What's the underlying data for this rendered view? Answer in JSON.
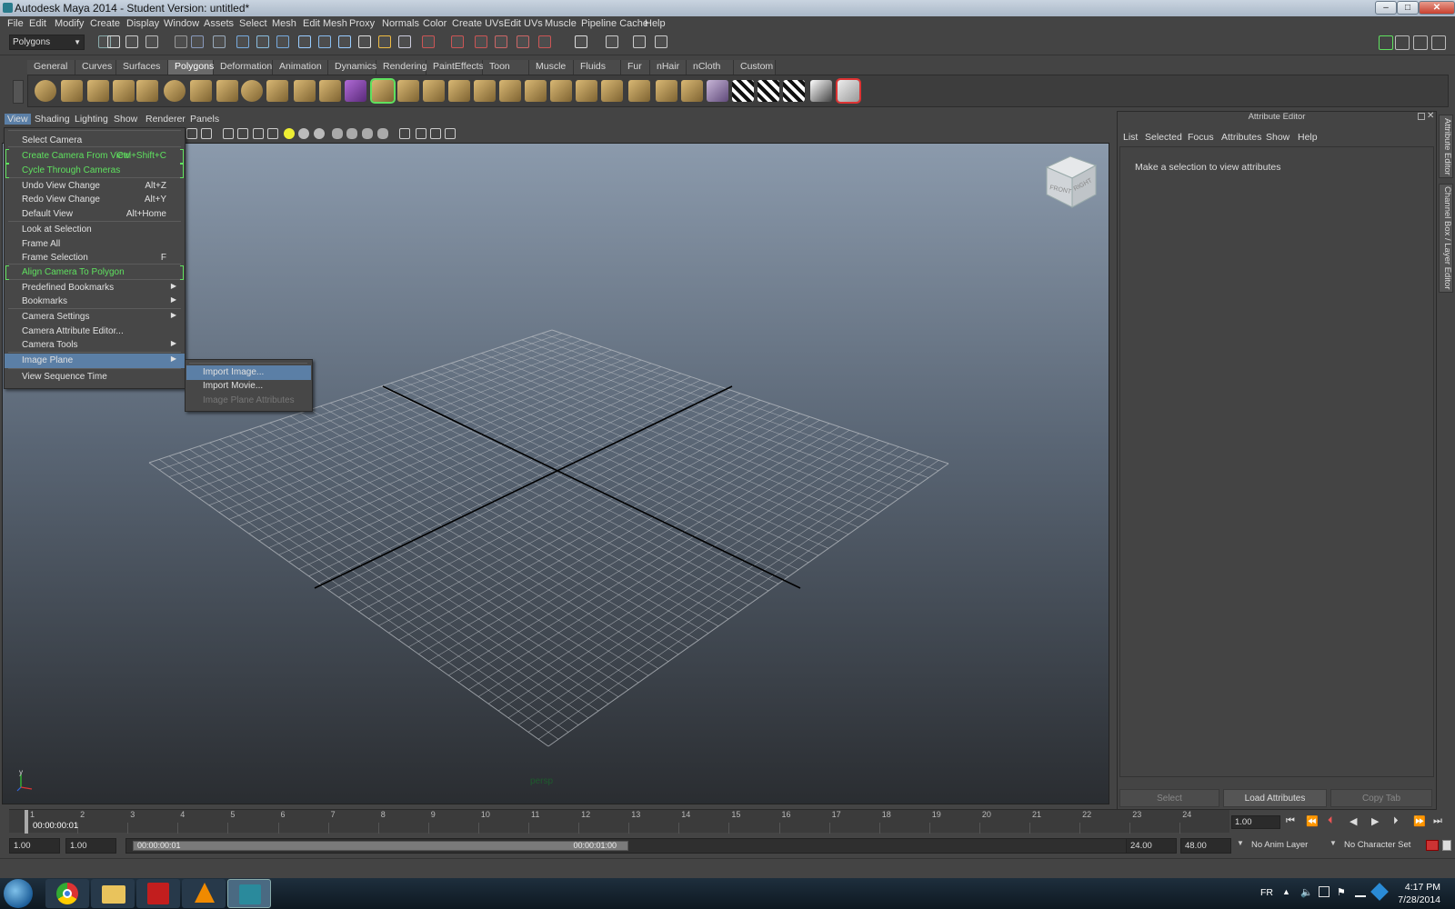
{
  "window": {
    "title": "Autodesk Maya 2014 - Student Version: untitled*",
    "controls": [
      "–",
      "□",
      "✕"
    ]
  },
  "menubar": [
    "File",
    "Edit",
    "Modify",
    "Create",
    "Display",
    "Window",
    "Assets",
    "Select",
    "Mesh",
    "Edit Mesh",
    "Proxy",
    "Normals",
    "Color",
    "Create UVs",
    "Edit UVs",
    "Muscle",
    "Pipeline Cache",
    "Help"
  ],
  "status_line": {
    "mode": "Polygons"
  },
  "shelf": {
    "tabs": [
      "General",
      "Curves",
      "Surfaces",
      "Polygons",
      "Deformation",
      "Animation",
      "Dynamics",
      "Rendering",
      "PaintEffects",
      "Toon",
      "Muscle",
      "Fluids",
      "Fur",
      "nHair",
      "nCloth",
      "Custom"
    ],
    "active_tab": "Polygons"
  },
  "viewport": {
    "menu": [
      "View",
      "Shading",
      "Lighting",
      "Show",
      "Renderer",
      "Panels"
    ],
    "camera_label": "persp",
    "viewcube": {
      "front": "FRONT",
      "right": "RIGHT"
    },
    "axis_label": "y"
  },
  "view_menu": {
    "items": [
      {
        "label": "Select Camera",
        "shortcut": "",
        "green": false,
        "submenu": false
      },
      {
        "label": "Create Camera From View",
        "shortcut": "Ctrl+Shift+C",
        "green": true,
        "submenu": false
      },
      {
        "label": "Cycle Through Cameras",
        "shortcut": "",
        "green": true,
        "submenu": false
      },
      {
        "label": "Undo View Change",
        "shortcut": "Alt+Z",
        "green": false,
        "submenu": false
      },
      {
        "label": "Redo View Change",
        "shortcut": "Alt+Y",
        "green": false,
        "submenu": false
      },
      {
        "label": "Default View",
        "shortcut": "Alt+Home",
        "green": false,
        "submenu": false
      },
      {
        "label": "Look at Selection",
        "shortcut": "",
        "green": false,
        "submenu": false
      },
      {
        "label": "Frame All",
        "shortcut": "",
        "green": false,
        "submenu": false
      },
      {
        "label": "Frame Selection",
        "shortcut": "F",
        "green": false,
        "submenu": false
      },
      {
        "label": "Align Camera To Polygon",
        "shortcut": "",
        "green": true,
        "submenu": false
      },
      {
        "label": "Predefined Bookmarks",
        "shortcut": "",
        "green": false,
        "submenu": true
      },
      {
        "label": "Bookmarks",
        "shortcut": "",
        "green": false,
        "submenu": true
      },
      {
        "label": "Camera Settings",
        "shortcut": "",
        "green": false,
        "submenu": true
      },
      {
        "label": "Camera Attribute Editor...",
        "shortcut": "",
        "green": false,
        "submenu": false
      },
      {
        "label": "Camera Tools",
        "shortcut": "",
        "green": false,
        "submenu": true
      },
      {
        "label": "Image Plane",
        "shortcut": "",
        "green": false,
        "submenu": true,
        "selected": true
      },
      {
        "label": "View Sequence Time",
        "shortcut": "",
        "green": false,
        "submenu": false
      }
    ]
  },
  "image_plane_submenu": {
    "items": [
      {
        "label": "Import Image...",
        "selected": true,
        "disabled": false
      },
      {
        "label": "Import Movie...",
        "selected": false,
        "disabled": false
      },
      {
        "label": "Image Plane Attributes",
        "selected": false,
        "disabled": true
      }
    ]
  },
  "attribute_editor": {
    "title": "Attribute Editor",
    "menu": [
      "List",
      "Selected",
      "Focus",
      "Attributes",
      "Show",
      "Help"
    ],
    "message": "Make a selection to view attributes",
    "buttons": [
      "Select",
      "Load Attributes",
      "Copy Tab"
    ],
    "side_tabs": [
      "Attribute Editor",
      "Channel Box / Layer Editor"
    ]
  },
  "time_slider": {
    "ticks": [
      "1",
      "2",
      "3",
      "4",
      "5",
      "6",
      "7",
      "8",
      "9",
      "10",
      "11",
      "12",
      "13",
      "14",
      "15",
      "16",
      "17",
      "18",
      "19",
      "20",
      "21",
      "22",
      "23",
      "24"
    ],
    "current_time": "00:00:00:01",
    "current_frame": "1.00"
  },
  "range_slider": {
    "start": "1.00",
    "playback_start": "1.00",
    "range_start_label": "00:00:00:01",
    "range_end_label": "00:00:01:00",
    "playback_end": "24.00",
    "end": "48.00",
    "anim_layer": "No Anim Layer",
    "character_set": "No Character Set"
  },
  "taskbar": {
    "language": "FR",
    "time": "4:17 PM",
    "date": "7/28/2014"
  },
  "colors": {
    "menu_green": "#5fe15f",
    "selection_blue": "#5b7fa6",
    "shelf_active": "#6a6a6a"
  }
}
